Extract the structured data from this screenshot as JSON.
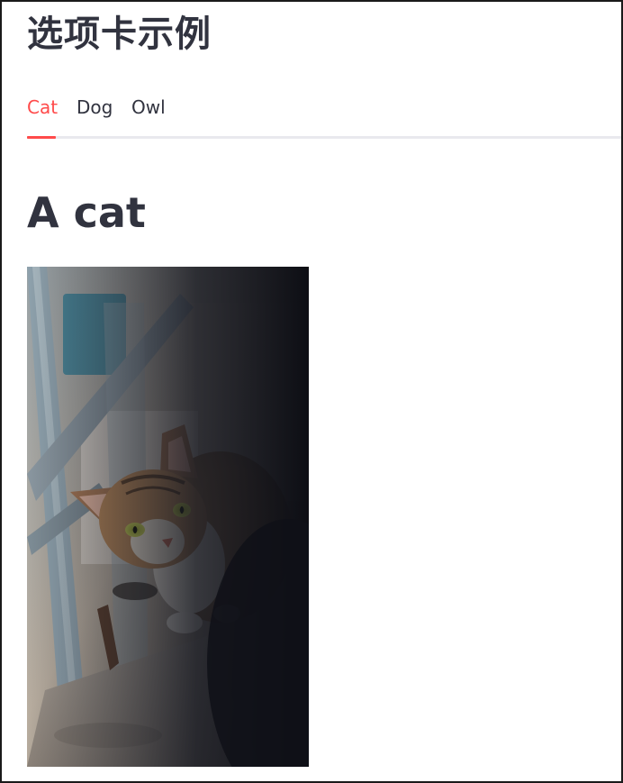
{
  "page": {
    "title": "选项卡示例"
  },
  "tabs": [
    {
      "label": "Cat",
      "active": true
    },
    {
      "label": "Dog",
      "active": false
    },
    {
      "label": "Owl",
      "active": false
    }
  ],
  "content": {
    "heading": "A cat",
    "image": {
      "subject": "tabby cat crouching on a concrete ledge beside a metal railing",
      "icon": "cat-photo"
    }
  },
  "colors": {
    "accent": "#ff4b4b",
    "text": "#31333f",
    "tab_track": "#e9e9ee"
  }
}
